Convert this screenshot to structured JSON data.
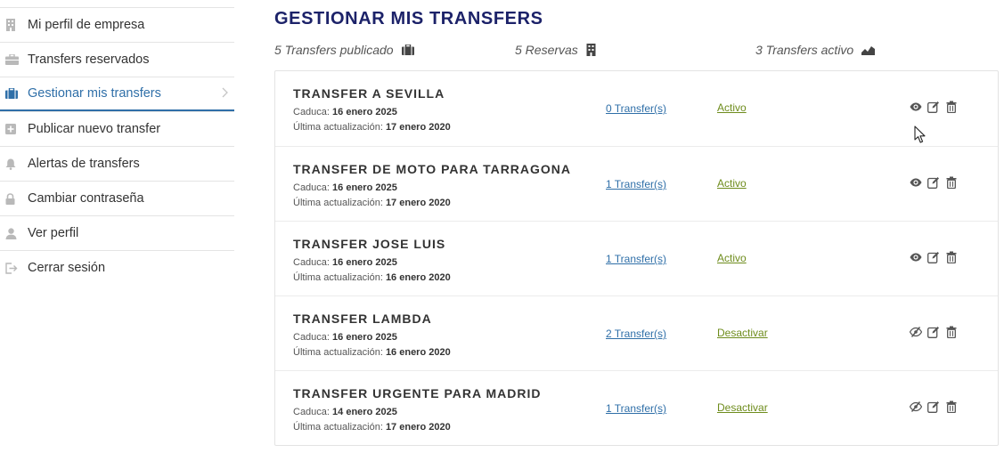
{
  "sidebar": {
    "items": [
      {
        "label": "Mi perfil de empresa",
        "icon": "building-icon",
        "active": false
      },
      {
        "label": "Transfers reservados",
        "icon": "briefcase-icon",
        "active": false
      },
      {
        "label": "Gestionar mis transfers",
        "icon": "suitcase-icon",
        "active": true
      },
      {
        "label": "Publicar nuevo transfer",
        "icon": "plus-square-icon",
        "active": false
      },
      {
        "label": "Alertas de transfers",
        "icon": "bell-icon",
        "active": false
      },
      {
        "label": "Cambiar contraseña",
        "icon": "lock-icon",
        "active": false
      },
      {
        "label": "Ver perfil",
        "icon": "user-icon",
        "active": false
      },
      {
        "label": "Cerrar sesión",
        "icon": "logout-icon",
        "active": false
      }
    ]
  },
  "main": {
    "title": "GESTIONAR MIS TRANSFERS",
    "stats": [
      {
        "text": "5 Transfers publicado",
        "icon": "suitcase-icon"
      },
      {
        "text": "5 Reservas",
        "icon": "building-icon"
      },
      {
        "text": "3 Transfers activo",
        "icon": "area-chart-icon"
      }
    ],
    "labels": {
      "expires": "Caduca:",
      "updated": "Última actualización:"
    },
    "transfers": [
      {
        "title": "TRANSFER A SEVILLA",
        "expires": "16 enero 2025",
        "updated": "17 enero 2020",
        "count": "0 Transfer(s)",
        "status": "Activo",
        "visible": true
      },
      {
        "title": "TRANSFER DE MOTO PARA TARRAGONA",
        "expires": "16 enero 2025",
        "updated": "17 enero 2020",
        "count": "1 Transfer(s)",
        "status": "Activo",
        "visible": true
      },
      {
        "title": "TRANSFER JOSE LUIS",
        "expires": "16 enero 2025",
        "updated": "16 enero 2020",
        "count": "1 Transfer(s)",
        "status": "Activo",
        "visible": true
      },
      {
        "title": "TRANSFER LAMBDA",
        "expires": "16 enero 2025",
        "updated": "16 enero 2020",
        "count": "2 Transfer(s)",
        "status": "Desactivar",
        "visible": false
      },
      {
        "title": "TRANSFER URGENTE PARA MADRID",
        "expires": "14 enero 2025",
        "updated": "17 enero 2020",
        "count": "1 Transfer(s)",
        "status": "Desactivar",
        "visible": false
      }
    ]
  },
  "colors": {
    "title": "#1c2269",
    "accent": "#2f6fa8",
    "status": "#6e8c1c"
  }
}
